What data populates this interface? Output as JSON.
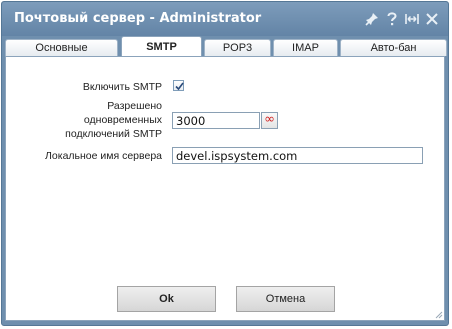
{
  "window": {
    "title": "Почтовый сервер - Administrator",
    "icons": [
      "pin-icon",
      "help-icon",
      "maximize-icon",
      "close-icon"
    ]
  },
  "tabs": [
    {
      "label": "Основные",
      "active": false
    },
    {
      "label": "SMTP",
      "active": true
    },
    {
      "label": "POP3",
      "active": false
    },
    {
      "label": "IMAP",
      "active": false
    },
    {
      "label": "Авто-бан",
      "active": false
    }
  ],
  "form": {
    "enable_smtp": {
      "label": "Включить SMTP",
      "checked": true
    },
    "max_connections": {
      "label_line1": "Разрешено",
      "label_line2": "одновременных",
      "label_line3": "подключений SMTP",
      "value": "3000",
      "infinity_symbol": "∞"
    },
    "server_name": {
      "label": "Локальное имя сервера",
      "value": "devel.ispsystem.com"
    }
  },
  "buttons": {
    "ok": "Ok",
    "cancel": "Отмена"
  },
  "colors": {
    "titlebar": "#6f8fae",
    "infinity": "#d02020"
  }
}
